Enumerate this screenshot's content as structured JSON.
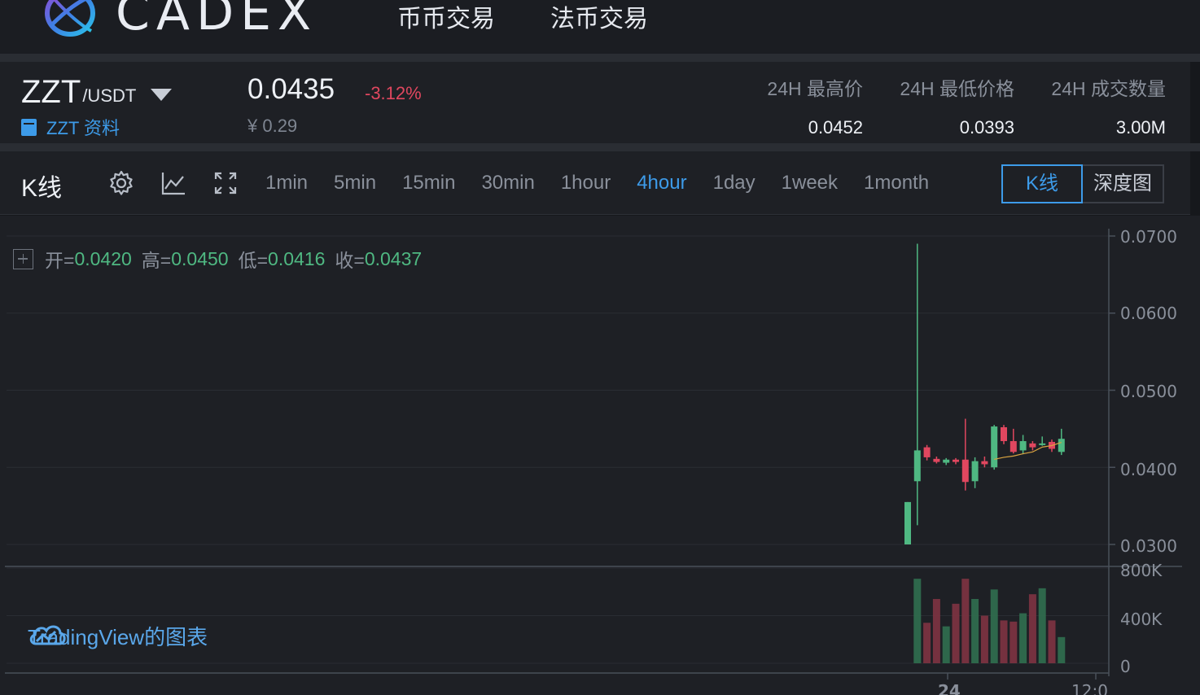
{
  "header": {
    "logo_text": "CADEX",
    "nav": [
      "币币交易",
      "法币交易"
    ]
  },
  "ticker": {
    "base": "ZZT",
    "quote": "/USDT",
    "info_link": "ZZT 资料",
    "last_price": "0.0435",
    "change": "-3.12%",
    "cny": "¥ 0.29",
    "stats": [
      {
        "label": "24H 最高价",
        "value": "0.0452"
      },
      {
        "label": "24H 最低价格",
        "value": "0.0393"
      },
      {
        "label": "24H 成交数量",
        "value": "3.00M"
      }
    ]
  },
  "toolbar": {
    "title": "K线",
    "intervals": [
      "1min",
      "5min",
      "15min",
      "30min",
      "1hour",
      "4hour",
      "1day",
      "1week",
      "1month"
    ],
    "active_interval": "4hour",
    "views": [
      "K线",
      "深度图"
    ],
    "active_view": "K线",
    "icons": [
      "gear-icon",
      "indicator-icon",
      "fullscreen-icon"
    ]
  },
  "legend": {
    "open_label": "开=",
    "open": "0.0420",
    "high_label": "高=",
    "high": "0.0450",
    "low_label": "低=",
    "low": "0.0416",
    "close_label": "收=",
    "close": "0.0437"
  },
  "branding": "TradingView的图表",
  "colors": {
    "up": "#4fb882",
    "down": "#e0475f",
    "accent": "#3d9be9",
    "background": "#1e2025"
  },
  "chart_data": {
    "type": "candlestick",
    "price_ticks": [
      "0.0700",
      "0.0600",
      "0.0500",
      "0.0400",
      "0.0300"
    ],
    "volume_ticks": [
      "800K",
      "400K",
      "0"
    ],
    "time_ticks": [
      "24",
      "12:0"
    ],
    "price_range": [
      0.03,
      0.07
    ],
    "volume_range": [
      0,
      800000
    ],
    "candles": [
      {
        "o": 0.03,
        "h": 0.0355,
        "l": 0.03,
        "c": 0.0355
      },
      {
        "o": 0.0382,
        "h": 0.069,
        "l": 0.0325,
        "c": 0.0422
      },
      {
        "o": 0.0426,
        "h": 0.0429,
        "l": 0.0409,
        "c": 0.0413
      },
      {
        "o": 0.0411,
        "h": 0.0414,
        "l": 0.0405,
        "c": 0.0407
      },
      {
        "o": 0.0406,
        "h": 0.0412,
        "l": 0.0403,
        "c": 0.041
      },
      {
        "o": 0.041,
        "h": 0.0412,
        "l": 0.0404,
        "c": 0.0407
      },
      {
        "o": 0.041,
        "h": 0.0463,
        "l": 0.037,
        "c": 0.0381
      },
      {
        "o": 0.0382,
        "h": 0.0413,
        "l": 0.0373,
        "c": 0.0408
      },
      {
        "o": 0.0408,
        "h": 0.0414,
        "l": 0.04,
        "c": 0.0404
      },
      {
        "o": 0.04,
        "h": 0.0455,
        "l": 0.0397,
        "c": 0.0453
      },
      {
        "o": 0.0452,
        "h": 0.0455,
        "l": 0.043,
        "c": 0.0434
      },
      {
        "o": 0.0434,
        "h": 0.045,
        "l": 0.0418,
        "c": 0.042
      },
      {
        "o": 0.0422,
        "h": 0.0442,
        "l": 0.0417,
        "c": 0.0434
      },
      {
        "o": 0.0431,
        "h": 0.0434,
        "l": 0.0422,
        "c": 0.0426
      },
      {
        "o": 0.043,
        "h": 0.044,
        "l": 0.0428,
        "c": 0.0431
      },
      {
        "o": 0.0433,
        "h": 0.0436,
        "l": 0.042,
        "c": 0.0424
      },
      {
        "o": 0.042,
        "h": 0.045,
        "l": 0.0416,
        "c": 0.0437
      }
    ],
    "volumes": [
      0,
      710000,
      340000,
      540000,
      310000,
      500000,
      710000,
      540000,
      400000,
      620000,
      360000,
      350000,
      420000,
      580000,
      630000,
      360000,
      220000
    ]
  }
}
